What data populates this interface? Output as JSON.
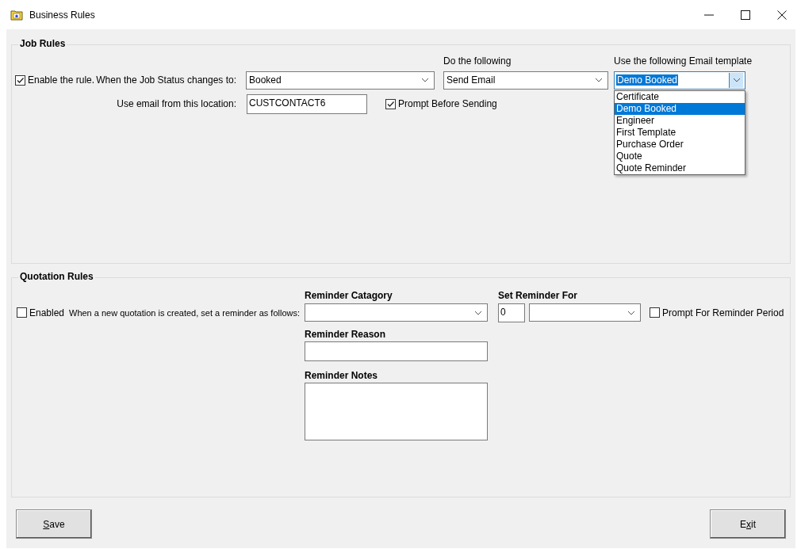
{
  "window": {
    "title": "Business Rules"
  },
  "job_rules": {
    "title": "Job Rules",
    "enable": {
      "label": "Enable the rule.",
      "checked": true
    },
    "status_label": "When the Job Status changes to:",
    "status_value": "Booked",
    "action_label": "Do the following",
    "action_value": "Send Email",
    "template_label": "Use the following Email template",
    "template_value": "Demo Booked",
    "template_open": true,
    "template_options": [
      {
        "label": "Certificate",
        "selected": false
      },
      {
        "label": "Demo Booked",
        "selected": true
      },
      {
        "label": "Engineer",
        "selected": false
      },
      {
        "label": "First Template",
        "selected": false
      },
      {
        "label": "Purchase Order",
        "selected": false
      },
      {
        "label": "Quote",
        "selected": false
      },
      {
        "label": "Quote Reminder",
        "selected": false
      }
    ],
    "email_label": "Use email from this location:",
    "email_value": "CUSTCONTACT6",
    "prompt": {
      "label": "Prompt Before Sending",
      "checked": true
    }
  },
  "quotation_rules": {
    "title": "Quotation Rules",
    "enabled": {
      "label": "Enabled",
      "checked": false
    },
    "description": "When a new quotation is created, set a reminder as follows:",
    "category_label": "Reminder Catagory",
    "reason_label": "Reminder Reason",
    "notes_label": "Reminder Notes",
    "set_for_label": "Set Reminder For",
    "set_for_value": "0",
    "prompt": {
      "label": "Prompt For Reminder Period",
      "checked": false
    }
  },
  "buttons": [
    {
      "access_key": "S",
      "label_rest": "ave"
    },
    {
      "label_start": "E",
      "access_key": "x",
      "label_rest": "it"
    }
  ]
}
